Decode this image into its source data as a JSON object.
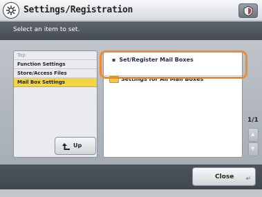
{
  "header": {
    "title": "Settings/Registration",
    "icon": "settings-wheel-icon",
    "shield_icon": "shield-icon"
  },
  "instruction": "Select an item to set.",
  "breadcrumb": [
    {
      "label": "Top"
    },
    {
      "label": "Function Settings"
    },
    {
      "label": "Store/Access Files"
    },
    {
      "label": "Mail Box Settings",
      "selected": true
    }
  ],
  "up_button": {
    "label": "Up",
    "icon": "up-arrow-icon"
  },
  "items": [
    {
      "label": "Set/Register Mail Boxes",
      "highlighted": true
    },
    {
      "label": "Settings for All Mail Boxes",
      "icon": "folder-icon"
    }
  ],
  "pagination": {
    "current": 1,
    "total": 1,
    "text": "1/1"
  },
  "footer": {
    "close_label": "Close"
  },
  "colors": {
    "highlight": "#f2892b",
    "selected": "#f2d641"
  }
}
